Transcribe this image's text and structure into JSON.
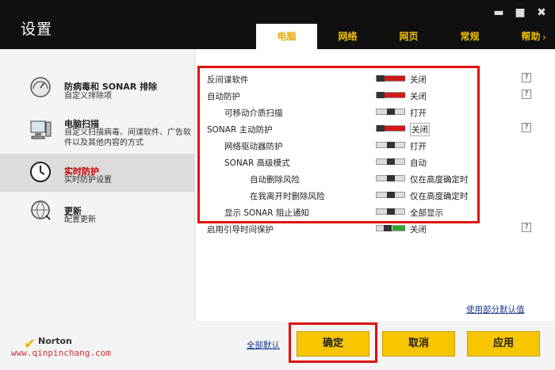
{
  "window": {
    "title": "设置"
  },
  "tabs": [
    "电脑",
    "网络",
    "网页",
    "常规",
    "帮助"
  ],
  "active_tab": "电脑",
  "sidebar": {
    "items": [
      {
        "title": "防病毒和 SONAR 排除",
        "subtitle": "自定义排除项",
        "icon": "gauge-icon",
        "active": false
      },
      {
        "title": "电脑扫描",
        "subtitle": "自定义扫描病毒、间谍软件、广告软件以及其他内容的方式",
        "icon": "computer-icon",
        "active": false
      },
      {
        "title": "实时防护",
        "subtitle": "实时防护设置",
        "icon": "clock-icon",
        "active": true
      },
      {
        "title": "更新",
        "subtitle": "配置更新",
        "icon": "globe-refresh-icon",
        "active": false
      }
    ]
  },
  "settings": [
    {
      "label": "反间谍软件",
      "state": "off",
      "status": "关闭",
      "help": "?"
    },
    {
      "label": "自动防护",
      "state": "off",
      "status": "关闭",
      "help": "?"
    },
    {
      "label": "可移动介质扫描",
      "state": "mid",
      "status": "打开",
      "help": ""
    },
    {
      "label": "SONAR 主动防护",
      "state": "off",
      "status": "关闭",
      "help": "?"
    },
    {
      "label": "网络驱动器防护",
      "state": "mid",
      "status": "打开",
      "help": ""
    },
    {
      "label": "SONAR 高级模式",
      "state": "mid",
      "status": "自动",
      "help": ""
    },
    {
      "label": "自动删除风险",
      "state": "mid",
      "status": "仅在高度确定时",
      "help": ""
    },
    {
      "label": "在我离开时删除风险",
      "state": "mid",
      "status": "仅在高度确定时",
      "help": ""
    },
    {
      "label": "显示 SONAR 阻止通知",
      "state": "mid",
      "status": "全部显示",
      "help": ""
    },
    {
      "label": "启用引导时间保护",
      "state": "on",
      "status": "关闭",
      "help": "?"
    }
  ],
  "links": {
    "use_defaults": "使用部分默认值",
    "all_defaults": "全部默认"
  },
  "buttons": {
    "ok": "确定",
    "cancel": "取消",
    "apply": "应用"
  },
  "brand": {
    "name": "Norton"
  },
  "watermark": "www.qinpinchang.com",
  "colors": {
    "accent": "#f7c600",
    "off": "#d01818",
    "on": "#2ea82e",
    "highlight": "#e01010"
  }
}
